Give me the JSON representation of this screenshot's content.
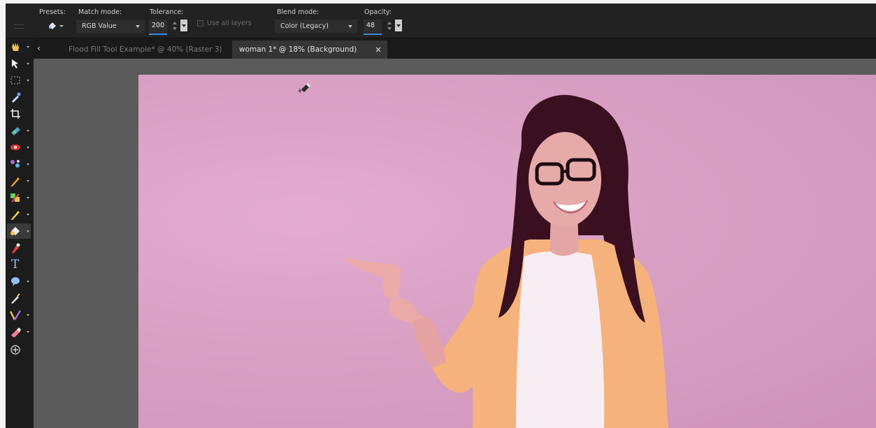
{
  "toolbar": {
    "presets_label": "Presets:",
    "match_mode_label": "Match mode:",
    "match_mode_value": "RGB Value",
    "tolerance_label": "Tolerance:",
    "tolerance_value": "200",
    "use_all_layers_label": "Use all layers",
    "use_all_layers_checked": false,
    "blend_mode_label": "Blend mode:",
    "blend_mode_value": "Color (Legacy)",
    "opacity_label": "Opacity:",
    "opacity_value": "48"
  },
  "tabs": [
    {
      "label": "Flood Fill Tool Example* @  40% (Raster 3)",
      "active": false
    },
    {
      "label": "woman 1* @  18% (Background)",
      "active": true,
      "close": "×"
    }
  ],
  "tools": [
    {
      "name": "pan-tool",
      "has_flyout": true
    },
    {
      "name": "pick-tool",
      "has_flyout": true
    },
    {
      "name": "selection-tool",
      "has_flyout": true
    },
    {
      "name": "dropper-tool",
      "has_flyout": false
    },
    {
      "name": "crop-tool",
      "has_flyout": false
    },
    {
      "name": "straighten-tool",
      "has_flyout": true
    },
    {
      "name": "red-eye-tool",
      "has_flyout": true
    },
    {
      "name": "clone-brush-tool",
      "has_flyout": true
    },
    {
      "name": "paint-brush-tool",
      "has_flyout": true
    },
    {
      "name": "color-replacer-tool",
      "has_flyout": true
    },
    {
      "name": "lighten-darken-tool",
      "has_flyout": true
    },
    {
      "name": "flood-fill-tool",
      "has_flyout": true,
      "active": true
    },
    {
      "name": "pen-tool",
      "has_flyout": false
    },
    {
      "name": "text-tool",
      "has_flyout": false,
      "glyph": "T"
    },
    {
      "name": "shape-tool",
      "has_flyout": true
    },
    {
      "name": "scratch-remover-tool",
      "has_flyout": false
    },
    {
      "name": "art-media-tool",
      "has_flyout": true
    },
    {
      "name": "eraser-tool",
      "has_flyout": true
    },
    {
      "name": "add-tool",
      "has_flyout": false
    }
  ],
  "colors": {
    "accent": "#3d8fe0",
    "canvas_bg": "#d9a0c4",
    "workspace": "#5b5b5b",
    "toolbar": "#222222"
  }
}
